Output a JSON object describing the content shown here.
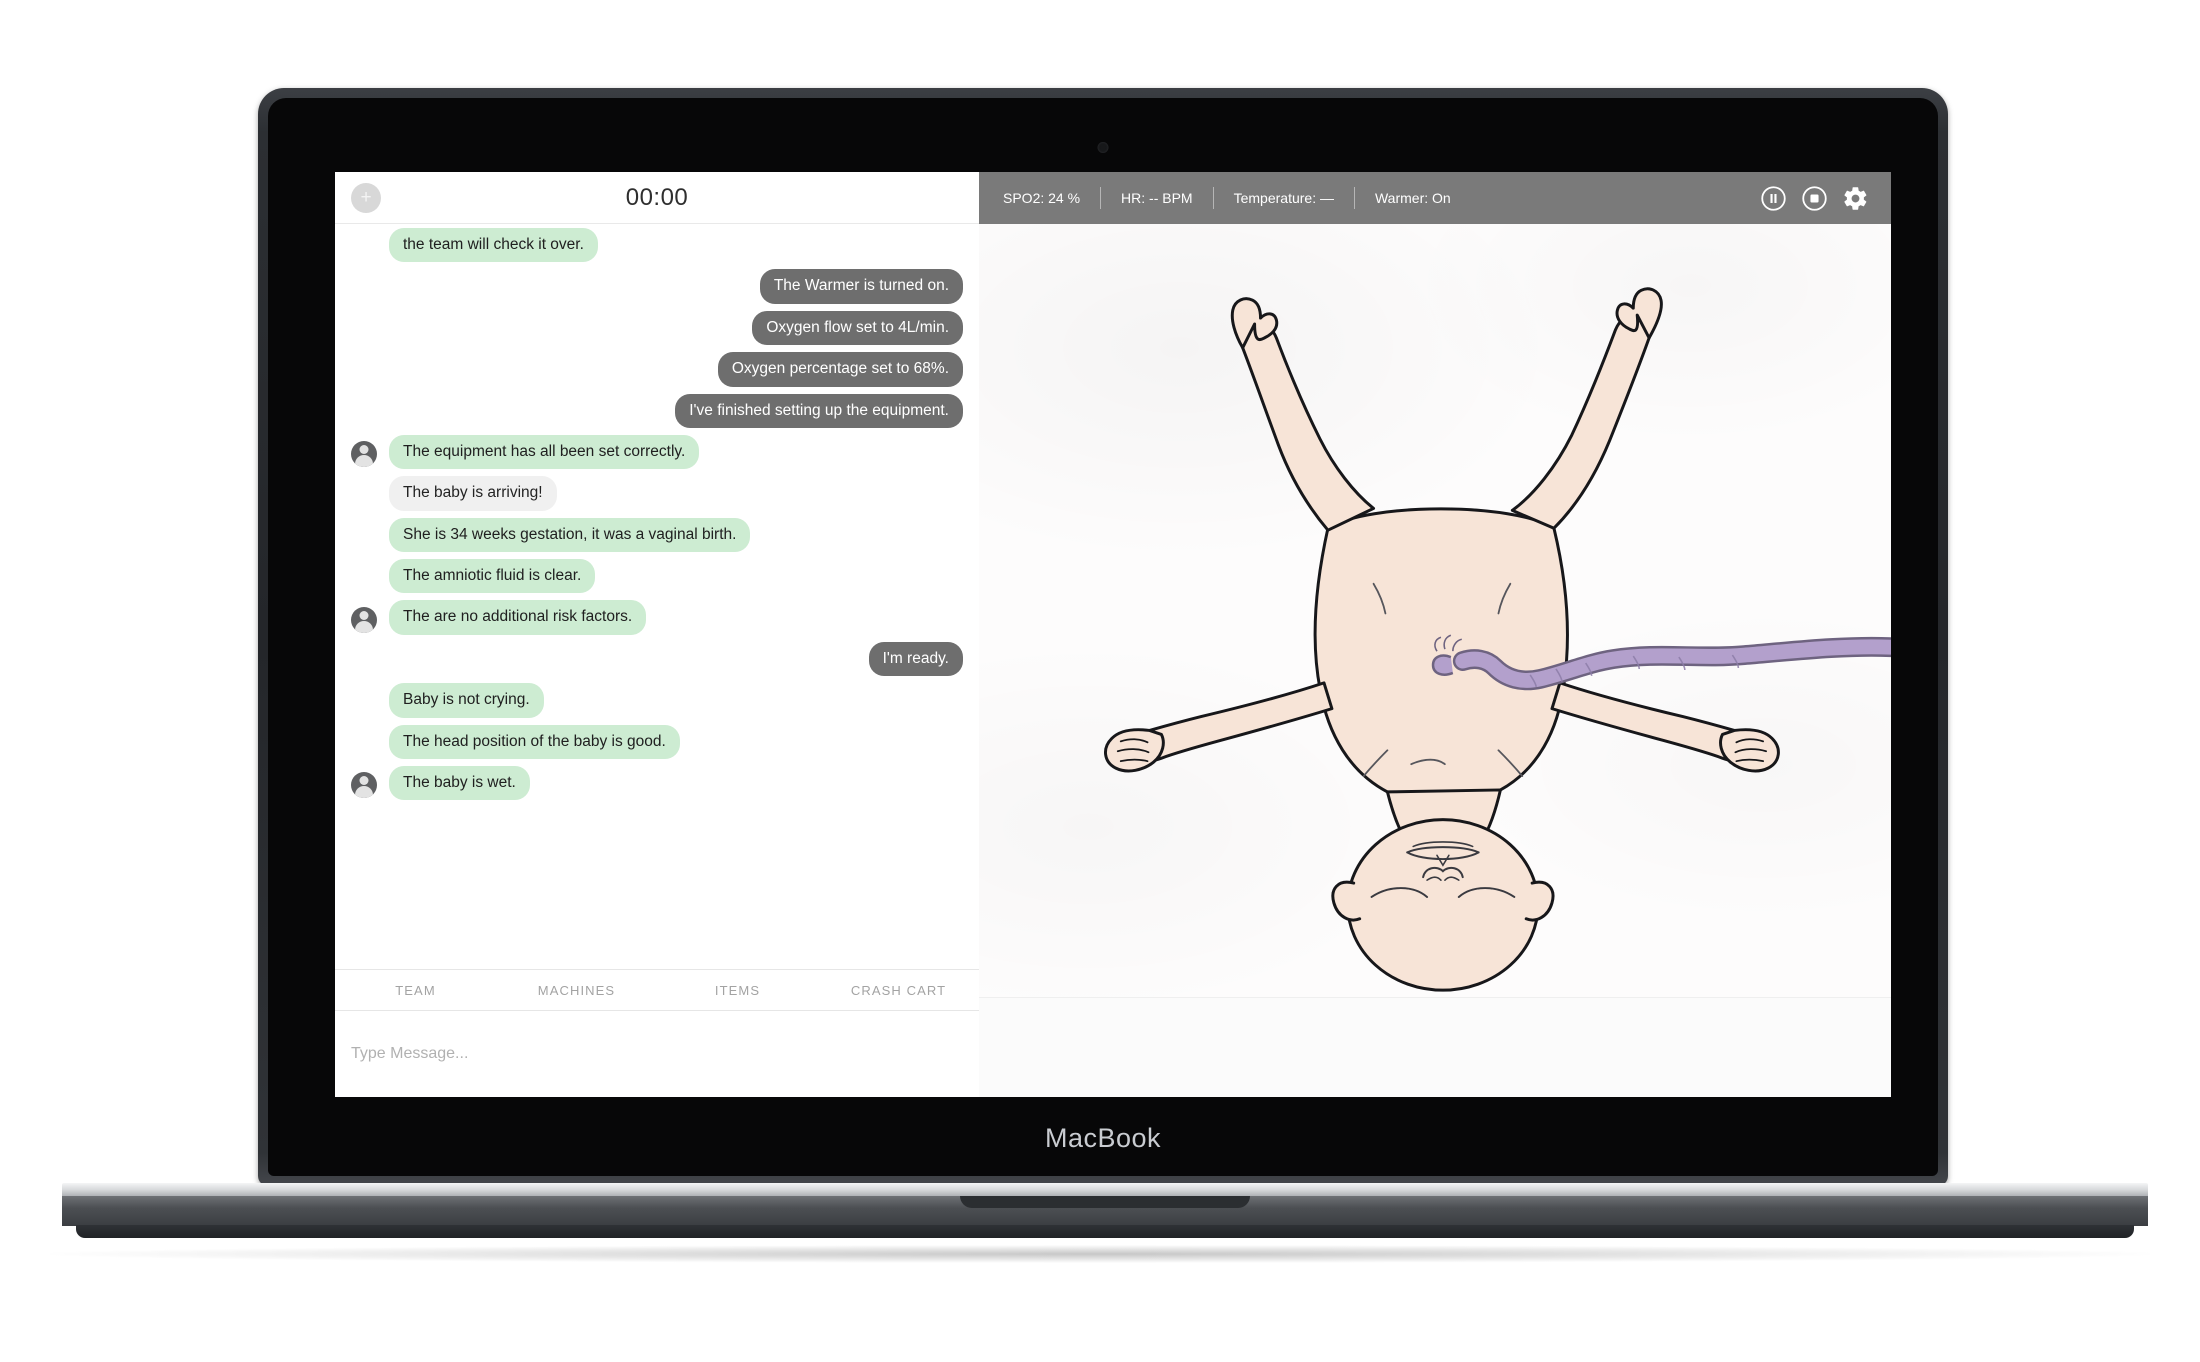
{
  "device": {
    "brand_label": "MacBook"
  },
  "chat_header": {
    "add_label": "+",
    "timer": "00:00"
  },
  "messages": [
    {
      "side": "in",
      "style": "in",
      "avatar": false,
      "text": "the team will check it over."
    },
    {
      "side": "out",
      "style": "out",
      "avatar": false,
      "text": "The Warmer is turned on."
    },
    {
      "side": "out",
      "style": "out",
      "avatar": false,
      "text": "Oxygen flow set to 4L/min."
    },
    {
      "side": "out",
      "style": "out",
      "avatar": false,
      "text": "Oxygen percentage set to 68%."
    },
    {
      "side": "out",
      "style": "out",
      "avatar": false,
      "text": "I've finished setting up the equipment."
    },
    {
      "side": "in",
      "style": "in",
      "avatar": true,
      "text": "The equipment has all been set correctly."
    },
    {
      "side": "in",
      "style": "event",
      "avatar": false,
      "text": "The baby is arriving!"
    },
    {
      "side": "in",
      "style": "in",
      "avatar": false,
      "text": "She is 34 weeks gestation, it was a vaginal birth."
    },
    {
      "side": "in",
      "style": "in",
      "avatar": false,
      "text": "The amniotic fluid is clear."
    },
    {
      "side": "in",
      "style": "in",
      "avatar": true,
      "text": "The are no additional risk factors."
    },
    {
      "side": "out",
      "style": "out",
      "avatar": false,
      "text": "I'm ready."
    },
    {
      "side": "in",
      "style": "in",
      "avatar": false,
      "text": "Baby is not crying."
    },
    {
      "side": "in",
      "style": "in",
      "avatar": false,
      "text": "The head position of the baby is good."
    },
    {
      "side": "in",
      "style": "in",
      "avatar": true,
      "text": "The baby is wet."
    }
  ],
  "tabs": [
    {
      "label": "TEAM"
    },
    {
      "label": "MACHINES"
    },
    {
      "label": "ITEMS"
    },
    {
      "label": "CRASH CART"
    }
  ],
  "composer": {
    "placeholder": "Type Message...",
    "value": ""
  },
  "statusbar": {
    "items": [
      {
        "label": "SPO2: 24 %"
      },
      {
        "label": "HR: -- BPM"
      },
      {
        "label": "Temperature: —"
      },
      {
        "label": "Warmer: On"
      }
    ],
    "icons": [
      {
        "name": "pause-icon"
      },
      {
        "name": "stop-icon"
      },
      {
        "name": "gear-icon"
      }
    ]
  },
  "stage": {
    "subject": "newborn-infant-illustration",
    "orientation": "head-down",
    "cord_color": "#b3a0cc",
    "skin_color": "#f7e4d7"
  },
  "colors": {
    "bubble_in": "#cdecd2",
    "bubble_out": "#6e6e6e",
    "bubble_event": "#f0f0f0",
    "statusbar_bg": "#7a7a7a"
  }
}
